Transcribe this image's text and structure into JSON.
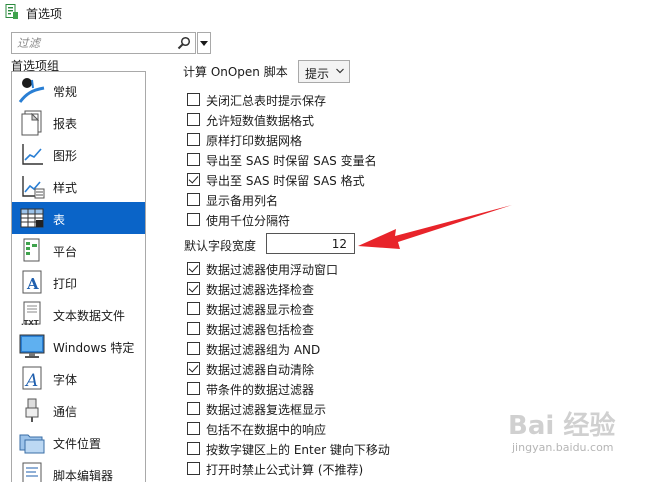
{
  "window": {
    "title": "首选项"
  },
  "filter": {
    "placeholder": "过滤"
  },
  "groups": {
    "label": "首选项组",
    "items": [
      {
        "label": "常规",
        "icon": "general-icon"
      },
      {
        "label": "报表",
        "icon": "report-icon"
      },
      {
        "label": "图形",
        "icon": "graph-icon"
      },
      {
        "label": "样式",
        "icon": "style-icon"
      },
      {
        "label": "表",
        "icon": "table-icon",
        "selected": true
      },
      {
        "label": "平台",
        "icon": "platform-icon"
      },
      {
        "label": "打印",
        "icon": "print-icon"
      },
      {
        "label": "文本数据文件",
        "icon": "text-data-file-icon"
      },
      {
        "label": "Windows 特定",
        "icon": "windows-specific-icon"
      },
      {
        "label": "字体",
        "icon": "font-icon"
      },
      {
        "label": "通信",
        "icon": "communication-icon"
      },
      {
        "label": "文件位置",
        "icon": "file-location-icon"
      },
      {
        "label": "脚本编辑器",
        "icon": "script-editor-icon"
      }
    ]
  },
  "table_prefs": {
    "script_label": "计算 OnOpen 脚本",
    "script_value": "提示",
    "options_a": [
      {
        "label": "关闭汇总表时提示保存",
        "checked": false
      },
      {
        "label": "允许短数值数据格式",
        "checked": false
      },
      {
        "label": "原样打印数据网格",
        "checked": false
      },
      {
        "label": "导出至 SAS 时保留 SAS 变量名",
        "checked": false
      },
      {
        "label": "导出至 SAS 时保留 SAS 格式",
        "checked": true
      },
      {
        "label": "显示备用列名",
        "checked": false
      },
      {
        "label": "使用千位分隔符",
        "checked": false
      }
    ],
    "field_width_label": "默认字段宽度",
    "field_width_value": "12",
    "options_b": [
      {
        "label": "数据过滤器使用浮动窗口",
        "checked": true
      },
      {
        "label": "数据过滤器选择检查",
        "checked": true
      },
      {
        "label": "数据过滤器显示检查",
        "checked": false
      },
      {
        "label": "数据过滤器包括检查",
        "checked": false
      },
      {
        "label": "数据过滤器组为 AND",
        "checked": false
      },
      {
        "label": "数据过滤器自动清除",
        "checked": true
      },
      {
        "label": "带条件的数据过滤器",
        "checked": false
      },
      {
        "label": "数据过滤器复选框显示",
        "checked": false
      },
      {
        "label": "包括不在数据中的响应",
        "checked": false
      },
      {
        "label": "按数字键区上的 Enter 键向下移动",
        "checked": false
      },
      {
        "label": "打开时禁止公式计算 (不推荐)",
        "checked": false
      }
    ]
  },
  "annotation": {
    "arrow_color": "#e8242a"
  },
  "colors": {
    "selection": "#0a64c8"
  },
  "watermark": {
    "logo": "Bai 经验",
    "url": "jingyan.baidu.com"
  }
}
